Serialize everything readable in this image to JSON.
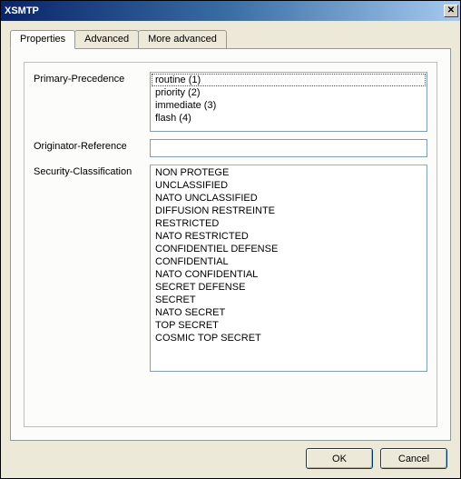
{
  "window": {
    "title": "XSMTP",
    "close_glyph": "✕"
  },
  "tabs": [
    {
      "label": "Properties",
      "active": true
    },
    {
      "label": "Advanced",
      "active": false
    },
    {
      "label": "More advanced",
      "active": false
    }
  ],
  "form": {
    "primary_precedence": {
      "label": "Primary-Precedence",
      "items": [
        "routine (1)",
        "priority (2)",
        "immediate (3)",
        "flash (4)"
      ],
      "selected_index": 0
    },
    "originator_reference": {
      "label": "Originator-Reference",
      "value": ""
    },
    "security_classification": {
      "label": "Security-Classification",
      "items": [
        "NON PROTEGE",
        "UNCLASSIFIED",
        "NATO UNCLASSIFIED",
        "DIFFUSION RESTREINTE",
        "RESTRICTED",
        "NATO RESTRICTED",
        "CONFIDENTIEL DEFENSE",
        "CONFIDENTIAL",
        "NATO CONFIDENTIAL",
        "SECRET DEFENSE",
        "SECRET",
        "NATO SECRET",
        "TOP SECRET",
        "COSMIC TOP SECRET"
      ]
    }
  },
  "buttons": {
    "ok": "OK",
    "cancel": "Cancel"
  }
}
